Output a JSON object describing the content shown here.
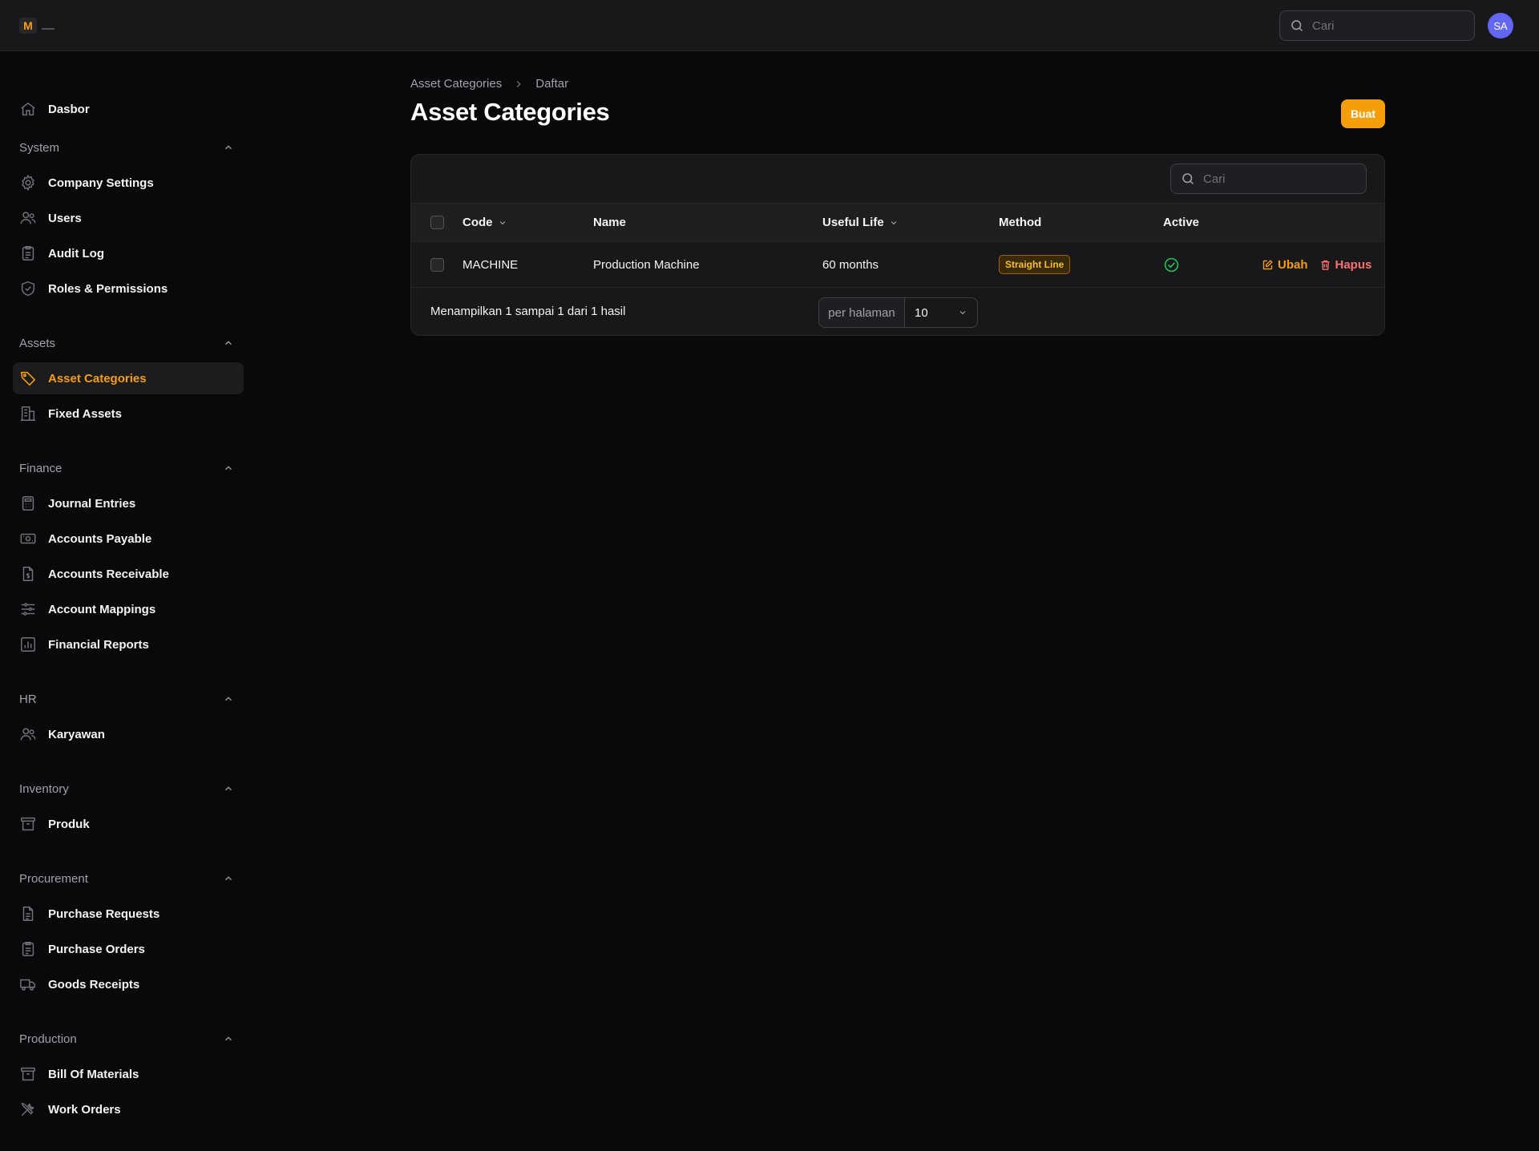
{
  "topbar": {
    "logo_letter": "M",
    "search_placeholder": "Cari",
    "avatar_initials": "SA"
  },
  "sidebar": {
    "dashboard": "Dasbor",
    "groups": [
      {
        "label": "System",
        "items": [
          "Company Settings",
          "Users",
          "Audit Log",
          "Roles & Permissions"
        ]
      },
      {
        "label": "Assets",
        "items": [
          "Asset Categories",
          "Fixed Assets"
        ]
      },
      {
        "label": "Finance",
        "items": [
          "Journal Entries",
          "Accounts Payable",
          "Accounts Receivable",
          "Account Mappings",
          "Financial Reports"
        ]
      },
      {
        "label": "HR",
        "items": [
          "Karyawan"
        ]
      },
      {
        "label": "Inventory",
        "items": [
          "Produk"
        ]
      },
      {
        "label": "Procurement",
        "items": [
          "Purchase Requests",
          "Purchase Orders",
          "Goods Receipts"
        ]
      },
      {
        "label": "Production",
        "items": [
          "Bill Of Materials",
          "Work Orders"
        ]
      }
    ],
    "active_item": "Asset Categories"
  },
  "breadcrumb": {
    "parent": "Asset Categories",
    "current": "Daftar"
  },
  "page": {
    "title": "Asset Categories",
    "create_label": "Buat"
  },
  "table": {
    "search_placeholder": "Cari",
    "columns": {
      "code": "Code",
      "name": "Name",
      "useful_life": "Useful Life",
      "method": "Method",
      "active": "Active"
    },
    "rows": [
      {
        "code": "MACHINE",
        "name": "Production Machine",
        "useful_life": "60 months",
        "method": "Straight Line",
        "active": true,
        "edit_label": "Ubah",
        "delete_label": "Hapus"
      }
    ],
    "summary": "Menampilkan 1 sampai 1 dari 1 hasil",
    "per_page_label": "per halaman",
    "per_page_value": "10"
  },
  "colors": {
    "accent": "#f59e0b",
    "danger": "#f87171",
    "success": "#22c55e",
    "avatar": "#6366f1"
  }
}
